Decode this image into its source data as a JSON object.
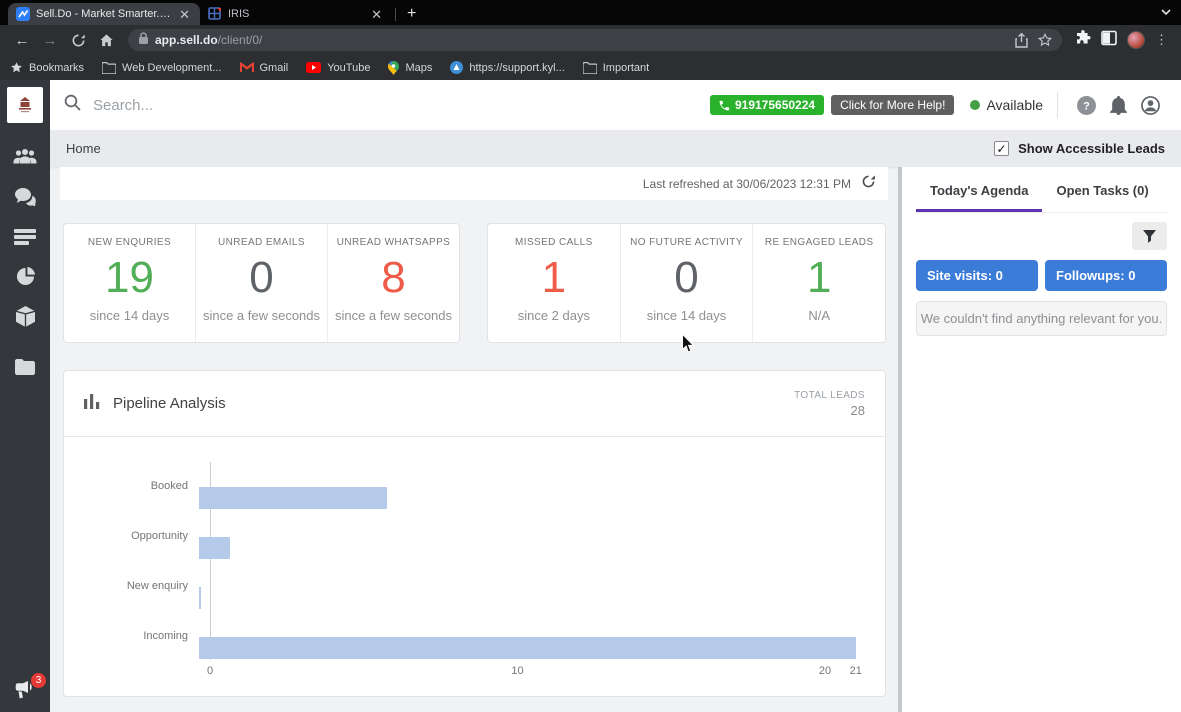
{
  "browser": {
    "tab1": "Sell.Do - Market Smarter. Sell",
    "tab2": "IRIS",
    "url_domain": "app.sell.do",
    "url_path": "/client/0/",
    "bookmarks": {
      "b1": "Bookmarks",
      "b2": "Web Development...",
      "b3": "Gmail",
      "b4": "YouTube",
      "b5": "Maps",
      "b6": "https://support.kyl...",
      "b7": "Important"
    }
  },
  "header": {
    "search_placeholder": "Search...",
    "phone_number": "919175650224",
    "help_button": "Click for More Help!",
    "availability": "Available"
  },
  "breadcrumb": {
    "title": "Home",
    "leads_toggle": "Show Accessible Leads",
    "checkmark": "✓"
  },
  "main": {
    "last_refreshed": "Last refreshed at 30/06/2023 12:31 PM"
  },
  "stats": {
    "cells": [
      {
        "label": "NEW ENQURIES",
        "value": "19",
        "caption": "since 14 days",
        "color": "#53ae58"
      },
      {
        "label": "UNREAD EMAILS",
        "value": "0",
        "caption": "since a few seconds",
        "color": "#5f6368"
      },
      {
        "label": "UNREAD WHATSAPPS",
        "value": "8",
        "caption": "since a few seconds",
        "color": "#ef5b49"
      },
      {
        "label": "MISSED CALLS",
        "value": "1",
        "caption": "since 2 days",
        "color": "#ef5b49"
      },
      {
        "label": "NO FUTURE ACTIVITY",
        "value": "0",
        "caption": "since 14 days",
        "color": "#5f6368"
      },
      {
        "label": "RE ENGAGED LEADS",
        "value": "1",
        "caption": "N/A",
        "color": "#53ae58"
      }
    ]
  },
  "pipeline": {
    "title": "Pipeline Analysis",
    "total_label": "TOTAL LEADS",
    "total_value": "28"
  },
  "chart_data": {
    "type": "bar",
    "orientation": "horizontal",
    "title": "Pipeline Analysis",
    "categories": [
      "Booked",
      "Opportunity",
      "New enquiry",
      "Incoming"
    ],
    "values": [
      6,
      1,
      0,
      21
    ],
    "total_leads": 28,
    "xlim": [
      0,
      21.3
    ],
    "xticks": [
      0,
      10,
      20,
      21
    ],
    "bar_color": "#b4cae8",
    "grid": false,
    "legend": "none"
  },
  "agenda": {
    "tab_active": "Today's Agenda",
    "tab_inactive": "Open Tasks (0)",
    "site_visits": "Site visits: 0",
    "followups": "Followups: 0",
    "empty_message": "We couldn't find anything relevant for you."
  },
  "sidebar": {
    "announcement_badge": "3"
  }
}
